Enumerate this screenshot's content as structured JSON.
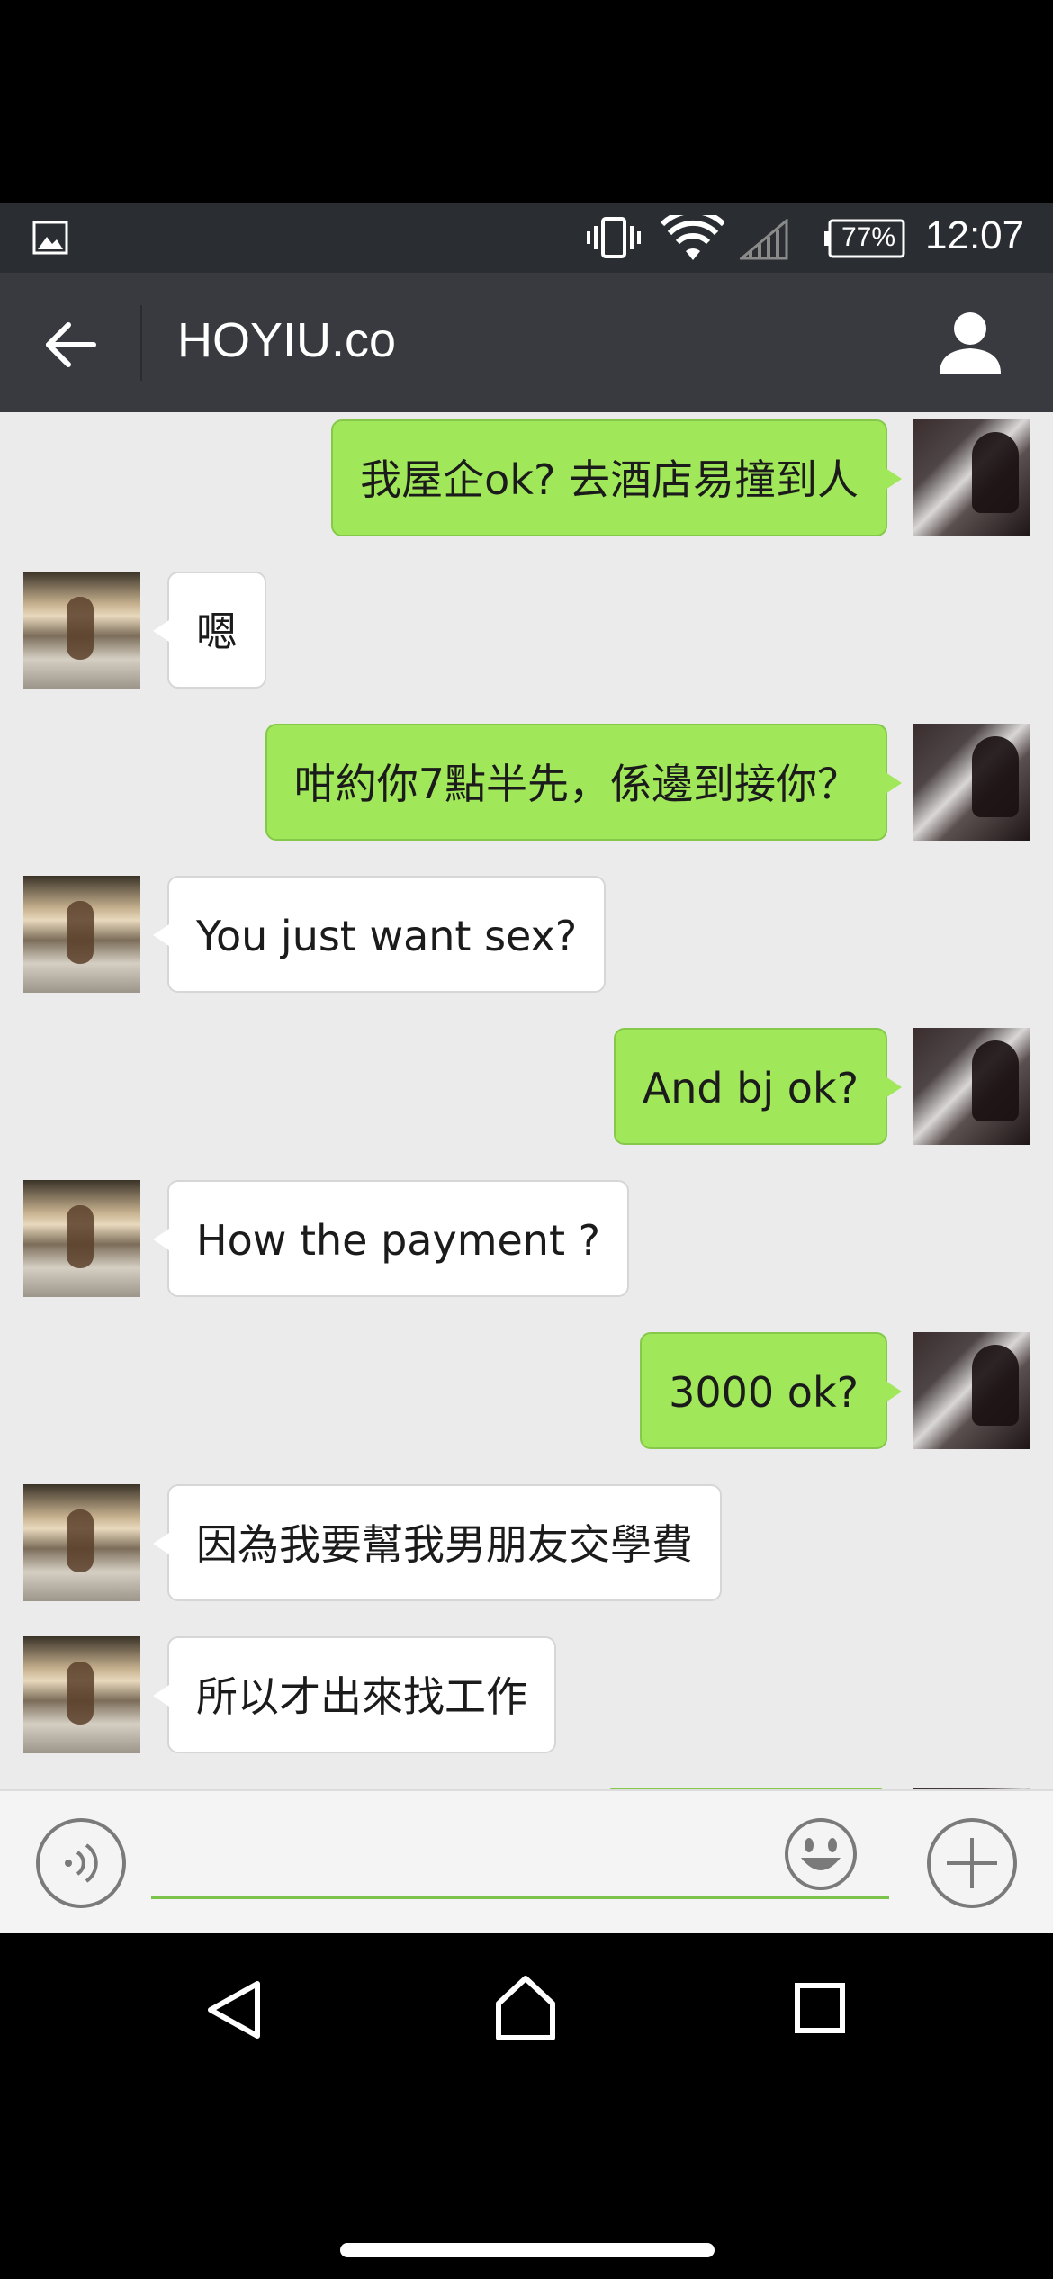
{
  "status_bar": {
    "battery": "77%",
    "time": "12:07",
    "icons": [
      "gallery-icon",
      "vibrate-icon",
      "wifi-icon",
      "signal-icon",
      "battery-icon"
    ]
  },
  "header": {
    "title": "HOYIU.co",
    "back_icon": "arrow-left-icon",
    "profile_icon": "person-icon"
  },
  "messages": [
    {
      "sender": "me",
      "text": "我屋企ok?  去酒店易撞到人"
    },
    {
      "sender": "peer",
      "text": "嗯"
    },
    {
      "sender": "me",
      "text": "咁約你7點半先，係邊到接你？"
    },
    {
      "sender": "peer",
      "text": "You just want sex?"
    },
    {
      "sender": "me",
      "text": "And bj ok?"
    },
    {
      "sender": "peer",
      "text": "How the payment ?"
    },
    {
      "sender": "me",
      "text": "3000 ok?"
    },
    {
      "sender": "peer",
      "text": "因為我要幫我男朋友交學費"
    },
    {
      "sender": "peer",
      "text": "所以才出來找工作"
    }
  ],
  "input_bar": {
    "placeholder": "",
    "voice_icon": "voice-icon",
    "emoji_icon": "emoji-icon",
    "plus_icon": "plus-icon"
  },
  "nav_bar": {
    "icons": [
      "nav-back-icon",
      "nav-home-icon",
      "nav-recent-icon"
    ]
  },
  "colors": {
    "header_bg": "#393a3f",
    "status_bg": "#2a2d31",
    "chat_bg": "#ebebeb",
    "my_bubble": "#a0e75a",
    "peer_bubble": "#ffffff",
    "input_accent": "#7cc34b"
  }
}
